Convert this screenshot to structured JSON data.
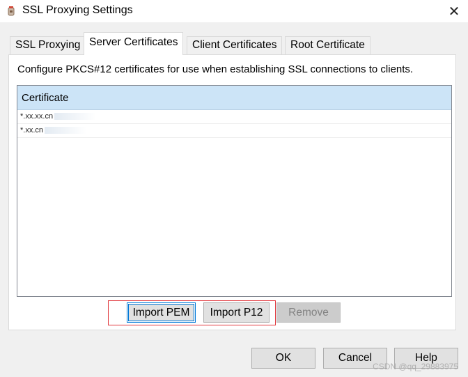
{
  "window": {
    "title": "SSL Proxying Settings",
    "app_icon": "charles-jug-icon",
    "close_glyph": "✕"
  },
  "tabs": [
    {
      "label": "SSL Proxying",
      "active": false
    },
    {
      "label": "Server Certificates",
      "active": true
    },
    {
      "label": "Client Certificates",
      "active": false
    },
    {
      "label": "Root Certificate",
      "active": false
    }
  ],
  "panel": {
    "description": "Configure PKCS#12 certificates for use when establishing SSL connections to clients.",
    "table": {
      "column_header": "Certificate",
      "rows": [
        "*.xx.xx.cn",
        "*.xx.cn"
      ]
    },
    "buttons": {
      "import_pem": "Import PEM",
      "import_p12": "Import P12",
      "remove": "Remove"
    }
  },
  "footer": {
    "ok": "OK",
    "cancel": "Cancel",
    "help": "Help"
  },
  "watermark": "CSDN @qq_29883975",
  "colors": {
    "header_bg": "#cce4f7",
    "highlight_border": "#e0353a",
    "focus_border": "#0078d7"
  }
}
